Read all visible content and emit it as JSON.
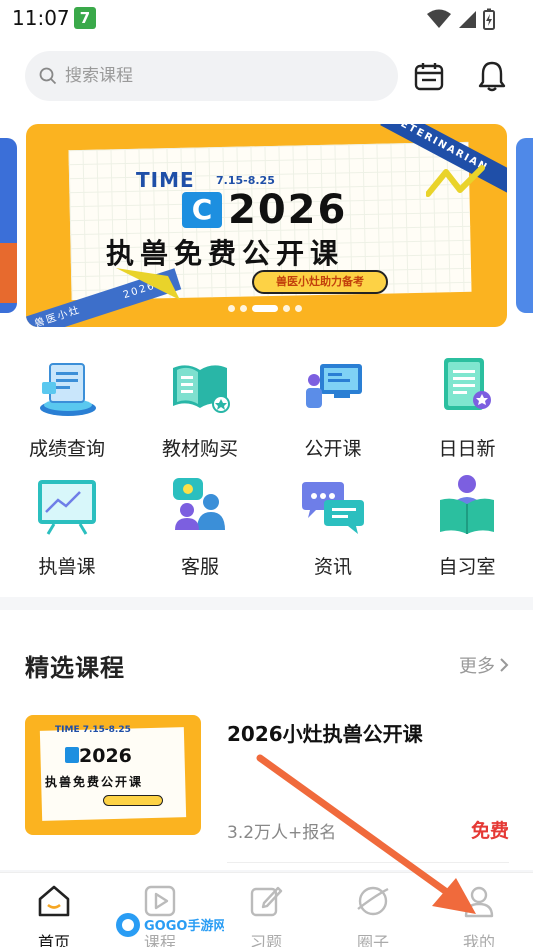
{
  "status_bar": {
    "time": "11:07",
    "badge": "7"
  },
  "search": {
    "placeholder": "搜索课程"
  },
  "banner": {
    "time_label": "TIME",
    "dates": "7.15-8.25",
    "ribbon": "VETERINARIAN",
    "year": "2026",
    "headline": "执兽免费公开课",
    "tag": "兽医小灶助力备考",
    "corner": "兽医小灶",
    "corner_year": "2026",
    "dots": 5,
    "active_dot": 2
  },
  "grid": [
    {
      "label": "成绩查询",
      "icon": "score-query-icon"
    },
    {
      "label": "教材购买",
      "icon": "textbook-icon"
    },
    {
      "label": "公开课",
      "icon": "open-class-icon"
    },
    {
      "label": "日日新",
      "icon": "daily-news-icon"
    },
    {
      "label": "执兽课",
      "icon": "vet-course-icon"
    },
    {
      "label": "客服",
      "icon": "customer-service-icon"
    },
    {
      "label": "资讯",
      "icon": "news-chat-icon"
    },
    {
      "label": "自习室",
      "icon": "study-room-icon"
    }
  ],
  "featured": {
    "title": "精选课程",
    "more": "更多",
    "course": {
      "title": "2026小灶执兽公开课",
      "count": "3.2万人+报名",
      "price": "免费",
      "thumb_time": "TIME 7.15-8.25",
      "thumb_year": "2026",
      "thumb_headline": "执兽免费公开课"
    }
  },
  "tabs": [
    {
      "label": "首页",
      "icon": "home-icon",
      "active": true
    },
    {
      "label": "课程",
      "icon": "play-course-icon",
      "active": false
    },
    {
      "label": "习题",
      "icon": "edit-exercise-icon",
      "active": false
    },
    {
      "label": "圈子",
      "icon": "circle-community-icon",
      "active": false
    },
    {
      "label": "我的",
      "icon": "profile-icon",
      "active": false
    }
  ],
  "watermark": "GOGO手游网",
  "colors": {
    "accent": "#fbb320",
    "brand_blue": "#1f4fa8",
    "price": "#e53935",
    "arrow": "#f06a3c"
  }
}
